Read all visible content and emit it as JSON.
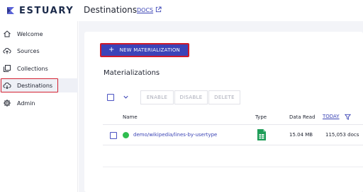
{
  "app": {
    "logo_text": "ESTUARY"
  },
  "header": {
    "title": "Destinations",
    "docs_label": "DOCS"
  },
  "sidebar": {
    "items": [
      {
        "label": "Welcome",
        "icon": "home-icon"
      },
      {
        "label": "Sources",
        "icon": "cloud-upload-icon"
      },
      {
        "label": "Collections",
        "icon": "collections-icon"
      },
      {
        "label": "Destinations",
        "icon": "cloud-download-icon",
        "active": true
      },
      {
        "label": "Admin",
        "icon": "gear-icon"
      }
    ]
  },
  "main": {
    "new_button_label": "NEW MATERIALIZATION",
    "section_title": "Materializations",
    "toolbar": {
      "enable_label": "ENABLE",
      "disable_label": "DISABLE",
      "delete_label": "DELETE"
    },
    "table": {
      "columns": {
        "name": "Name",
        "type": "Type",
        "data_read": "Data Read",
        "today": "TODAY"
      },
      "rows": [
        {
          "name": "demo/wikipedia/lines-by-usertype",
          "type_icon": "google-sheets-icon",
          "data_read": "15.04 MB",
          "docs": "115,053 docs",
          "status": "green"
        }
      ]
    }
  },
  "colors": {
    "accent": "#3c43b8",
    "highlight": "#d01a2a",
    "status_ok": "#2fbd4f"
  }
}
